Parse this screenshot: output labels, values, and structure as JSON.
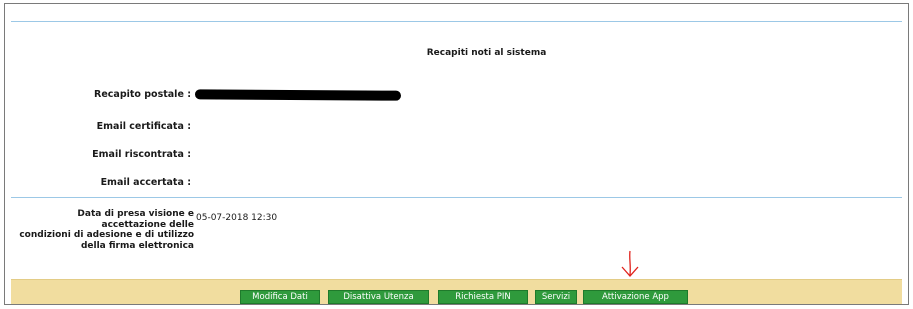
{
  "section_title": "Recapiti noti al sistema",
  "fields": [
    {
      "label": "Recapito postale :",
      "value": ""
    },
    {
      "label": "Email certificata :",
      "value": ""
    },
    {
      "label": "Email riscontrata :",
      "value": ""
    },
    {
      "label": "Email accertata :",
      "value": ""
    }
  ],
  "consent": {
    "label_lines": [
      "Data di presa visione e",
      "accettazione delle",
      "condizioni di adesione e di utilizzo",
      "della firma elettronica"
    ],
    "value": "05-07-2018 12:30"
  },
  "buttons": {
    "modifica": "Modifica Dati",
    "disattiva": "Disattiva Utenza",
    "pin": "Richiesta PIN",
    "servizi": "Servizi",
    "attivazione": "Attivazione App"
  },
  "colors": {
    "button_green": "#2f9a3c",
    "bar_yellow": "#f1dd9f",
    "rule_blue": "#9cc8e6",
    "annotation_red": "#e0211b"
  }
}
